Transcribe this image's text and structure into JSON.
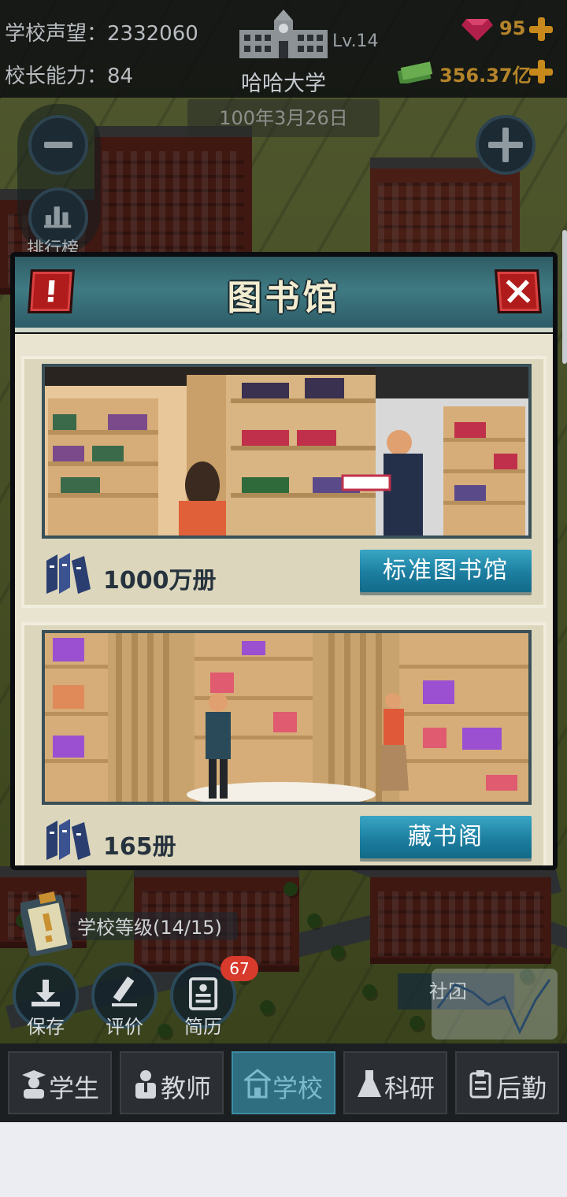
{
  "hud": {
    "reputation": "学校声望：2332060",
    "principal_ability": "校长能力：84",
    "level": "Lv.14",
    "school_name": "哈哈大学",
    "gems": "95",
    "money": "356.37亿",
    "date": "100年3月26日"
  },
  "side": {
    "ranking_label": "排行榜"
  },
  "modal": {
    "title": "图书馆",
    "options": [
      {
        "count": "1000万册",
        "button": "标准图书馆"
      },
      {
        "count": "165册",
        "button": "藏书阁"
      }
    ]
  },
  "bottom": {
    "school_level": "学校等级(14/15)",
    "actions": [
      {
        "label": "保存"
      },
      {
        "label": "评价"
      },
      {
        "label": "简历",
        "badge": "67"
      }
    ],
    "social": "社团"
  },
  "tabs": [
    {
      "label": "学生",
      "active": false
    },
    {
      "label": "教师",
      "active": false
    },
    {
      "label": "学校",
      "active": true
    },
    {
      "label": "科研",
      "active": false
    },
    {
      "label": "后勤",
      "active": false
    }
  ],
  "colors": {
    "header_teal": "#3f7a82",
    "button_blue": "#1c7ea0",
    "alert_red": "#b01c1c",
    "card_bg": "#dcd6bc",
    "active_tab": "#2f6e80"
  },
  "icons": [
    "school-building-icon",
    "gem-icon",
    "money-icon",
    "plus-icon",
    "minus-icon",
    "chart-icon",
    "alert-icon",
    "close-icon",
    "books-icon",
    "clipboard-icon",
    "download-icon",
    "pencil-icon",
    "resume-icon",
    "student-icon",
    "teacher-icon",
    "school-icon",
    "flask-icon",
    "logistics-icon"
  ]
}
